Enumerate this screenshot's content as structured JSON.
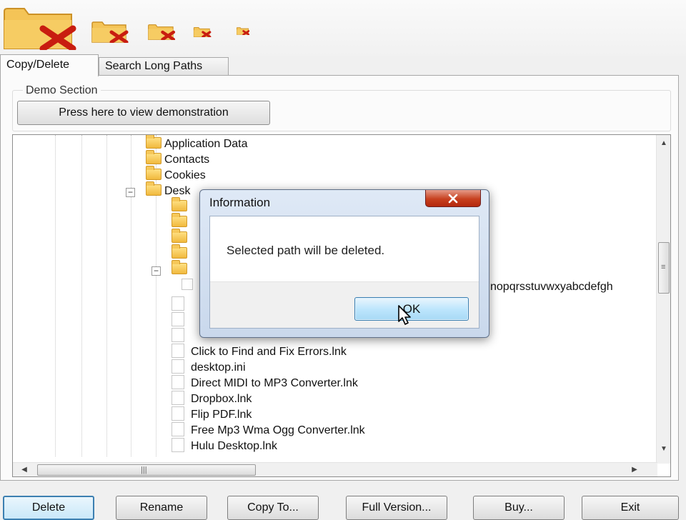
{
  "tabs": [
    {
      "label": "Copy/Delete",
      "active": true
    },
    {
      "label": "Search Long Paths",
      "active": false
    }
  ],
  "demo": {
    "title": "Demo Section",
    "button_label": "Press here to view demonstration"
  },
  "tree": {
    "folders": [
      {
        "label": "Application Data"
      },
      {
        "label": "Contacts"
      },
      {
        "label": "Cookies"
      },
      {
        "label": "Desk"
      }
    ],
    "long_path_fragment": "nopqrsstuvwxyabcdefgh",
    "files": [
      {
        "label": "Click to Find and Fix Errors.lnk"
      },
      {
        "label": "desktop.ini"
      },
      {
        "label": "Direct MIDI to MP3 Converter.lnk"
      },
      {
        "label": "Dropbox.lnk"
      },
      {
        "label": "Flip PDF.lnk"
      },
      {
        "label": "Free Mp3 Wma Ogg Converter.lnk"
      },
      {
        "label": "Hulu Desktop.lnk"
      }
    ]
  },
  "dialog": {
    "title": "Information",
    "message": "Selected path will be deleted.",
    "ok_label": "OK"
  },
  "bottom_buttons": [
    {
      "label": "Delete"
    },
    {
      "label": "Rename"
    },
    {
      "label": "Copy To..."
    },
    {
      "label": "Full Version..."
    },
    {
      "label": "Buy..."
    },
    {
      "label": "Exit"
    }
  ],
  "colors": {
    "folder": "#f1b93e",
    "delete_x": "#c81d10",
    "close_button": "#c7401f",
    "ok_button": "#bee6fd"
  },
  "icons": {
    "logo": "folder-delete-icon",
    "close": "close-icon",
    "cursor": "mouse-pointer-icon"
  }
}
